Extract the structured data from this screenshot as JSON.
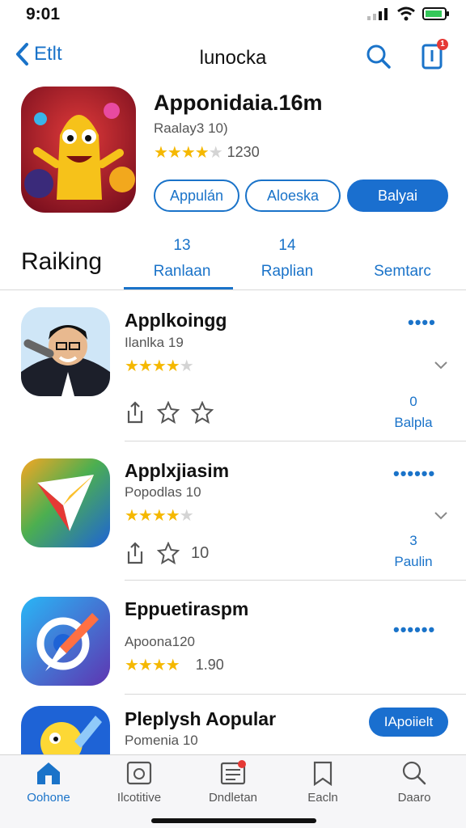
{
  "status": {
    "time": "9:01"
  },
  "nav": {
    "back_label": "Etlt",
    "title": "lunocka",
    "inbox_badge": "1"
  },
  "hero": {
    "title": "Apponidaia.16m",
    "subtitle": "Raalay3 10)",
    "stars": 3.5,
    "stars_text": "★★★★",
    "rating_count": "1230",
    "buttons": [
      "Appulán",
      "Aloeska",
      "Balyai"
    ]
  },
  "section": {
    "title": "Raiking",
    "tabs": [
      {
        "count": "13",
        "label": "Ranlaan"
      },
      {
        "count": "14",
        "label": "Raplian"
      },
      {
        "count": "",
        "label": "Semtarc"
      }
    ]
  },
  "apps": [
    {
      "name": "Applkoingg",
      "sub": "Ilanlka 19",
      "stars_full": "★★★★",
      "stars_off": "★",
      "count": "0",
      "count_label": "Balpla",
      "action_text": ""
    },
    {
      "name": "Applxjiasim",
      "sub": "Popodlas 10",
      "stars_full": "★★★★",
      "stars_off": "★",
      "count": "3",
      "count_label": "Paulin",
      "action_text": "10"
    },
    {
      "name": "Eppuetiraspm",
      "sub": "Apoona120",
      "stars_full": "★★★★",
      "stars_off": "",
      "rating_text": "1.90",
      "count": "",
      "count_label": ""
    },
    {
      "name": "Pleplysh Aopular",
      "sub": "Pomenia 10",
      "button": "IApoiielt"
    }
  ],
  "tabbar": [
    {
      "label": "Oohone",
      "icon": "home-icon",
      "active": true
    },
    {
      "label": "Ilcotitive",
      "icon": "frame-icon",
      "active": false
    },
    {
      "label": "Dndletan",
      "icon": "list-icon",
      "active": false
    },
    {
      "label": "Eacln",
      "icon": "bookmark-icon",
      "active": false
    },
    {
      "label": "Daaro",
      "icon": "search-icon",
      "active": false
    }
  ],
  "colors": {
    "accent": "#1a73c9",
    "star": "#f5b800",
    "badge": "#e53935"
  }
}
